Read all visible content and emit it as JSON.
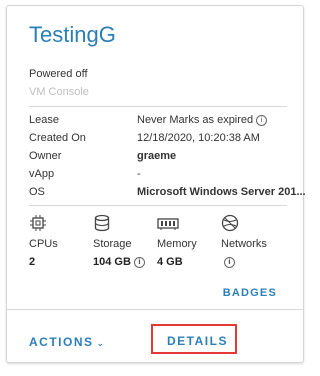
{
  "card": {
    "title": "TestingG",
    "power_status": "Powered off",
    "console_label": "VM Console",
    "details": [
      {
        "label": "Lease",
        "value": "Never Marks as expired",
        "info": true,
        "bold": false
      },
      {
        "label": "Created On",
        "value": "12/18/2020, 10:20:38 AM",
        "info": false,
        "bold": false
      },
      {
        "label": "Owner",
        "value": "graeme",
        "info": false,
        "bold": true
      },
      {
        "label": "vApp",
        "value": "-",
        "info": false,
        "bold": false
      },
      {
        "label": "OS",
        "value": "Microsoft Windows Server 201...",
        "info": false,
        "bold": true
      }
    ],
    "resources": {
      "cpus": {
        "label": "CPUs",
        "value": "2",
        "icon": "cpu-icon"
      },
      "storage": {
        "label": "Storage",
        "value": "104 GB",
        "icon": "storage-icon"
      },
      "memory": {
        "label": "Memory",
        "value": "4 GB",
        "icon": "memory-icon"
      },
      "networks": {
        "label": "Networks",
        "value": "",
        "icon": "network-icon"
      }
    },
    "badges_label": "BADGES",
    "actions_label": "ACTIONS",
    "details_label": "DETAILS"
  }
}
